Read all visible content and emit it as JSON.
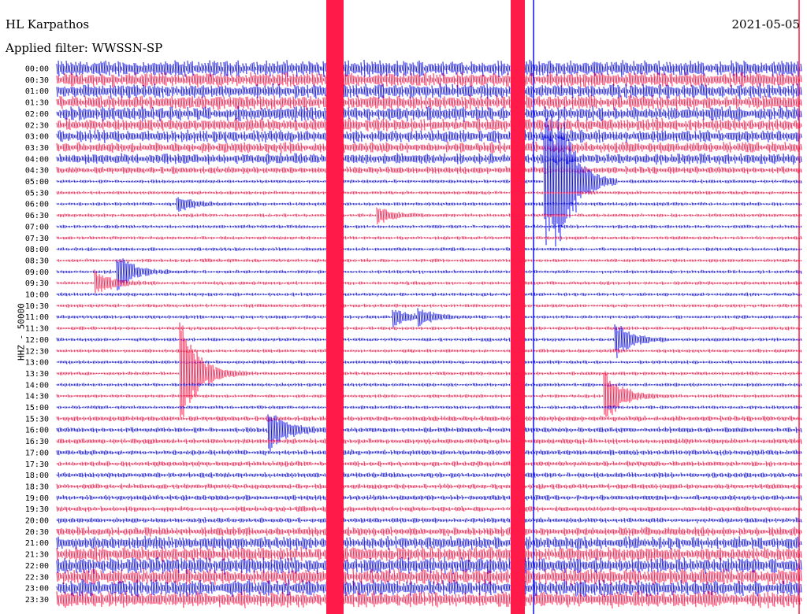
{
  "header": {
    "station": "HL Karpathos",
    "filter": "Applied filter: WWSSN-SP",
    "date": "2021-05-05",
    "channel_label": "HHZ - 50000"
  },
  "chart_data": {
    "type": "line",
    "title": "HL Karpathos",
    "subtitle": "Applied filter: WWSSN-SP",
    "date": "2021-05-05",
    "ylabel": "HHZ - 50000",
    "row_labels": [
      "00:00",
      "00:30",
      "01:00",
      "01:30",
      "02:00",
      "02:30",
      "03:00",
      "03:30",
      "04:00",
      "04:30",
      "05:00",
      "05:30",
      "06:00",
      "06:30",
      "07:00",
      "07:30",
      "08:00",
      "08:30",
      "09:00",
      "09:30",
      "10:00",
      "10:30",
      "11:00",
      "11:30",
      "12:00",
      "12:30",
      "13:00",
      "13:30",
      "14:00",
      "14:30",
      "15:00",
      "15:30",
      "16:00",
      "16:30",
      "17:00",
      "17:30",
      "18:00",
      "18:30",
      "19:00",
      "19:30",
      "20:00",
      "20:30",
      "21:00",
      "21:30",
      "22:00",
      "22:30",
      "23:00",
      "23:30"
    ],
    "colors": [
      "#1010ee",
      "#ff1a4a"
    ],
    "noise_amplitude": [
      9,
      8,
      8,
      8,
      8,
      7,
      7,
      6,
      6,
      4,
      2,
      2,
      2,
      2,
      2,
      2,
      2,
      2,
      2,
      2,
      2,
      2,
      2,
      2,
      2,
      2,
      2,
      2,
      2,
      2,
      2,
      3,
      3,
      3,
      3,
      3,
      3,
      3,
      3,
      3,
      3,
      5,
      7,
      8,
      9,
      9,
      9,
      9
    ],
    "events": [
      {
        "row": 10,
        "minute": 19.6,
        "amplitude": 300
      },
      {
        "row": 12,
        "minute": 4.8,
        "amplitude": 12
      },
      {
        "row": 13,
        "minute": 12.9,
        "amplitude": 10
      },
      {
        "row": 18,
        "minute": 2.4,
        "amplitude": 25
      },
      {
        "row": 19,
        "minute": 1.5,
        "amplitude": 16
      },
      {
        "row": 22,
        "minute": 13.5,
        "amplitude": 12
      },
      {
        "row": 22,
        "minute": 14.5,
        "amplitude": 10
      },
      {
        "row": 24,
        "minute": 22.5,
        "amplitude": 24
      },
      {
        "row": 27,
        "minute": 4.9,
        "amplitude": 90
      },
      {
        "row": 29,
        "minute": 22.0,
        "amplitude": 40
      },
      {
        "row": 32,
        "minute": 8.5,
        "amplitude": 30
      }
    ],
    "x_unit": "minutes after row start (0-30)"
  }
}
